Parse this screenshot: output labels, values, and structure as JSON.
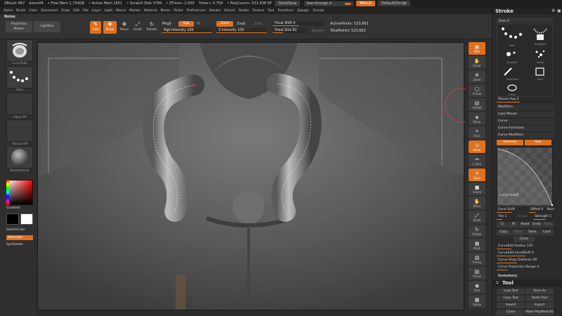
{
  "titlebar": {
    "app": "ZBrush 4R7",
    "doc": "demo04",
    "free_mem": "• Free Mem 1.754GB",
    "active_mem": "• Active Mem 1651",
    "scratch": "• Scratch Disk 3784",
    "ztime": "• ZTime≈ 2.000",
    "timer": "Timer≈ 0.759",
    "polycount": "• PolyCount≈ 531.638 KP",
    "quicksave": "QuickSave",
    "seethrough": "See-through  0",
    "menus": "Menus",
    "script": "DefaultZScript"
  },
  "menubar": [
    "Alpha",
    "Brush",
    "Color",
    "Document",
    "Draw",
    "Edit",
    "File",
    "Layer",
    "Light",
    "Macro",
    "Marker",
    "Material",
    "Movie",
    "Picker",
    "Preferences",
    "Render",
    "Stencil",
    "Stroke",
    "Texture",
    "Tool",
    "Transform",
    "Zplugin",
    "Zscript"
  ],
  "shelf": {
    "label_left": "Noise",
    "projection_master": "Projection Master",
    "lightbox": "LightBox",
    "edit": "Edit",
    "draw": "Draw",
    "move": "Move",
    "scale": "Scale",
    "rotate": "Rotate",
    "mrgb": "Mrgb",
    "rgb": "Rgb",
    "m": "M",
    "rgb_intensity": "Rgb Intensity 100",
    "zadd": "Zadd",
    "zsub": "Zsub",
    "zcut": "Zcut",
    "z_intensity": "Z Intensity 100",
    "focal_shift": "Focal Shift 0",
    "draw_size": "Draw Size 82",
    "dynamic": "Dynamic",
    "active_points": "ActivePoints: 523,663",
    "total_points": "TotalPoints: 523,663"
  },
  "leftshelf": {
    "brush_label": "CurveTube",
    "stroke_label": "Dots",
    "alpha_label": "Alpha Off",
    "texture_label": "Texture Off",
    "material_label": "BasicMaterial",
    "gradient": "Gradient",
    "switchcolor": "SwitchColor",
    "alternate": "Alternate",
    "spcpalette": "SpcPalette"
  },
  "rightshelf": [
    {
      "label": "SPix",
      "icon": "spix-icon",
      "glyph": "▣"
    },
    {
      "label": "Scroll",
      "icon": "scroll-hand-icon",
      "glyph": "✋"
    },
    {
      "label": "Zoom",
      "icon": "zoom-icon",
      "glyph": "⊕"
    },
    {
      "label": "Actual",
      "icon": "actual-icon",
      "glyph": "▢"
    },
    {
      "label": "AAHalf",
      "icon": "aahalf-icon",
      "glyph": "▤"
    },
    {
      "label": "Persp",
      "icon": "persp-icon",
      "glyph": "◈"
    },
    {
      "label": "Floor",
      "icon": "floor-icon",
      "glyph": "⌗"
    },
    {
      "label": "Local",
      "icon": "local-icon",
      "glyph": "◎"
    },
    {
      "label": "L.Sym",
      "icon": "lsym-icon",
      "glyph": "↔"
    },
    {
      "label": "Qxyz",
      "icon": "xyz-icon",
      "glyph": "✛"
    },
    {
      "label": "Frame",
      "icon": "frame-icon",
      "glyph": "■"
    },
    {
      "label": "Move",
      "icon": "move-icon",
      "glyph": "✋"
    },
    {
      "label": "Scale",
      "icon": "scale-icon",
      "glyph": "⤢"
    },
    {
      "label": "Rotate",
      "icon": "rotate-icon",
      "glyph": "↻"
    },
    {
      "label": "PolyF",
      "icon": "polyf-icon",
      "glyph": "▦"
    },
    {
      "label": "Transp",
      "icon": "transp-icon",
      "glyph": "▧"
    },
    {
      "label": "Ghost",
      "icon": "ghost-icon",
      "glyph": "▨"
    },
    {
      "label": "Solo",
      "icon": "solo-icon",
      "glyph": "◉"
    },
    {
      "label": "Xpose",
      "icon": "xpose-icon",
      "glyph": "▩"
    }
  ],
  "palette": {
    "stroke_title": "Stroke",
    "dots": "Dots  0",
    "stroke_types": [
      "Dots",
      "DragRect",
      "DragDot",
      "Spray",
      "FreeHand",
      "Rect",
      "Lasso"
    ],
    "mouse_avg": "Mouse Avg 4",
    "modifiers": "Modifiers",
    "lazy_mouse": "Lazy Mouse",
    "curve": "Curve",
    "curve_functions": "Curve Functions",
    "curve_modifiers": "Curve Modifiers",
    "intensity": "Intensity",
    "size": "Size",
    "curve_falloff": "Curve Falloff",
    "focal_shift": "Focal Shift",
    "offset": "Offset  0",
    "noise": "Noise",
    "tile": "Tile 1",
    "shape": "Shape",
    "strength": "Strength 1",
    "row_a": [
      "Cl",
      "Rl",
      "Reset",
      "Undo",
      "Redo"
    ],
    "row_b": [
      "Copy",
      "Paste",
      "Save",
      "Load"
    ],
    "close": "Close",
    "curve_edit_radius": "CurveEdit Radius 125",
    "curve_edit_focal": "CurveEdit FocalShift 0",
    "curve_snap": "Curve Snap Distance 60",
    "curve_proj": "Curve Projection Range 4",
    "inventory": "Inventory",
    "tool_title": "Tool",
    "tool_btns": [
      "Load Tool",
      "Save As",
      "Copy Tool",
      "Paste Tool",
      "Import",
      "Export",
      "Clone",
      "Make PolyMesh3D"
    ]
  },
  "colors": {
    "accent": "#e0701e",
    "ui_bg": "#2b2b2b",
    "canvas_bg": "#5a5a5a"
  }
}
